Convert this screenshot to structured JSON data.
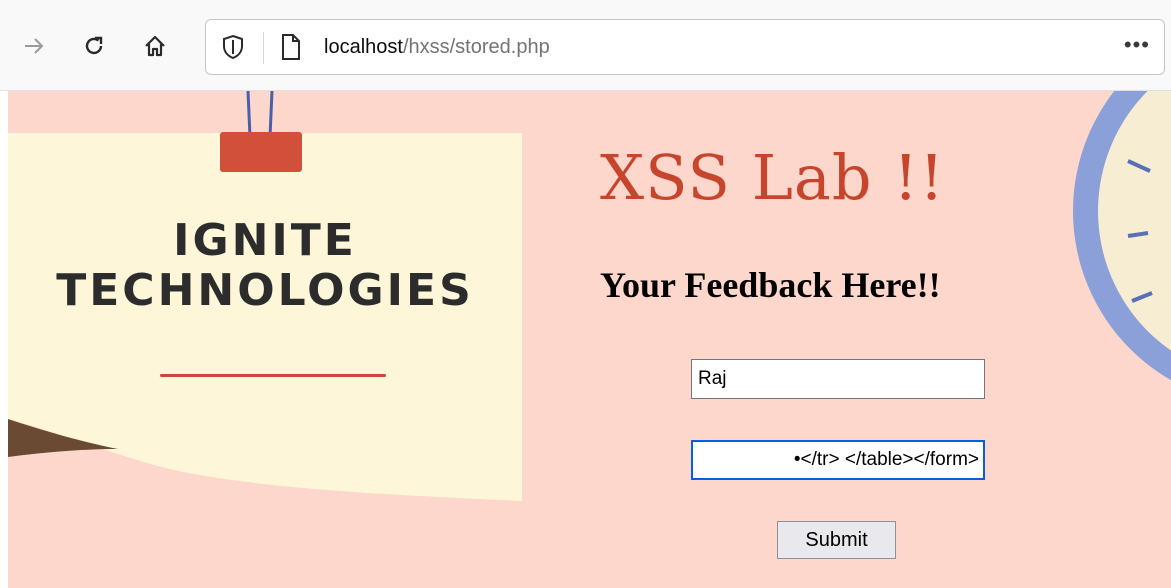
{
  "browser": {
    "url_host": "localhost",
    "url_path": "/hxss/stored.php",
    "more_glyph": "•••"
  },
  "logo": {
    "line1": "IGNITE",
    "line2": "TECHNOLOGIES"
  },
  "page": {
    "lab_title": "XSS Lab !!",
    "feedback_title": "Your Feedback Here!!",
    "name_value": "Raj",
    "message_value": "•</tr> </table></form>",
    "submit_label": "Submit"
  },
  "colors": {
    "background": "#fdd6cc",
    "title": "#c8452d",
    "focus": "#0060df"
  }
}
